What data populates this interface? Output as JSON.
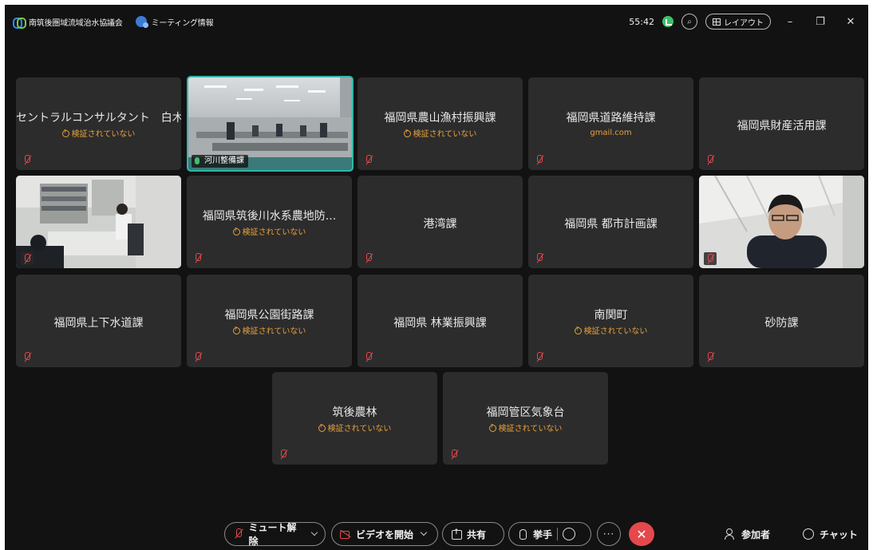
{
  "window": {
    "meeting_title": "南筑後圏域流域治水協議会",
    "meeting_info_label": "ミーティング情報",
    "elapsed_time": "55:42",
    "layout_label": "レイアウト",
    "minimize_glyph": "–",
    "restore_glyph": "❐",
    "close_glyph": "✕"
  },
  "tiles": [
    {
      "name": "セントラルコンサルタント　白木",
      "status": "検証されていない",
      "video": false
    },
    {
      "name": "河川整備課",
      "status": "",
      "video": true,
      "active_speaker": true
    },
    {
      "name": "福岡県農山漁村振興課",
      "status": "検証されていない",
      "video": false
    },
    {
      "name": "福岡県道路維持課",
      "status": "gmail.com",
      "video": false
    },
    {
      "name": "福岡県財産活用課",
      "status": "",
      "video": false
    },
    {
      "name": "",
      "status": "",
      "video": true
    },
    {
      "name": "福岡県筑後川水系農地防...",
      "status": "検証されていない",
      "video": false
    },
    {
      "name": "港湾課",
      "status": "",
      "video": false
    },
    {
      "name": "福岡県 都市計画課",
      "status": "",
      "video": false
    },
    {
      "name": "",
      "status": "",
      "video": true
    },
    {
      "name": "福岡県上下水道課",
      "status": "",
      "video": false
    },
    {
      "name": "福岡県公園街路課",
      "status": "検証されていない",
      "video": false
    },
    {
      "name": "福岡県 林業振興課",
      "status": "",
      "video": false
    },
    {
      "name": "南関町",
      "status": "検証されていない",
      "video": false
    },
    {
      "name": "砂防課",
      "status": "",
      "video": false
    },
    {
      "name": "筑後農林",
      "status": "検証されていない",
      "video": false
    },
    {
      "name": "福岡管区気象台",
      "status": "検証されていない",
      "video": false
    }
  ],
  "toolbar": {
    "unmute_label": "ミュート解除",
    "start_video_label": "ビデオを開始",
    "share_label": "共有",
    "raise_hand_label": "挙手",
    "more_label": "···",
    "end_label": "✕",
    "participants_label": "参加者",
    "chat_label": "チャット"
  },
  "colors": {
    "background": "#121212",
    "tile": "#2c2c2c",
    "unverified_text": "#e9a13b",
    "muted_mic": "#e5484d",
    "active_border": "#2fb8a9",
    "end_button": "#e5484d"
  }
}
